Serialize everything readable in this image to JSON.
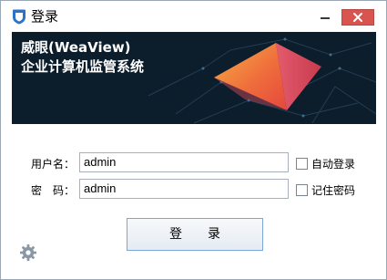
{
  "window": {
    "title": "登录",
    "icon": "shield-icon"
  },
  "banner": {
    "title": "威眼(WeaView)",
    "subtitle": "企业计算机监管系统"
  },
  "form": {
    "username_label": "用户名：",
    "username_value": "admin",
    "password_label": "密　码：",
    "password_value": "admin",
    "auto_login_label": "自动登录",
    "remember_password_label": "记住密码",
    "login_button": "登　　录"
  },
  "settings_icon": "gear-icon",
  "colors": {
    "banner_bg": "#0c1d2b",
    "close_button": "#d9534f",
    "accent_blue": "#2a73c9"
  }
}
